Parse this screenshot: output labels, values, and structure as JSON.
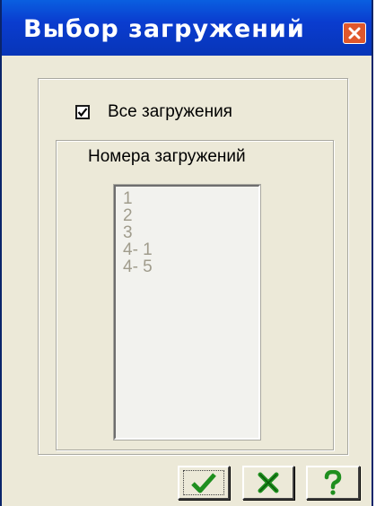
{
  "window": {
    "title": "Выбор загружений",
    "close_icon": "close-icon"
  },
  "checkbox": {
    "label": "Все загружения",
    "checked": true
  },
  "group": {
    "caption": "Номера загружений"
  },
  "list": {
    "items": [
      "1",
      "2",
      "3",
      "4- 1",
      "4- 5"
    ],
    "text_color": "#a09c8c"
  },
  "buttons": [
    {
      "icon": "check-icon",
      "color": "#1f8f1f"
    },
    {
      "icon": "cross-icon",
      "color": "#1f8f1f"
    },
    {
      "icon": "help-icon",
      "color": "#1f8f1f"
    }
  ],
  "colors": {
    "titlebar": "#0a3ccf",
    "window_bg": "#ece9d8",
    "close_button": "#e0572c"
  }
}
